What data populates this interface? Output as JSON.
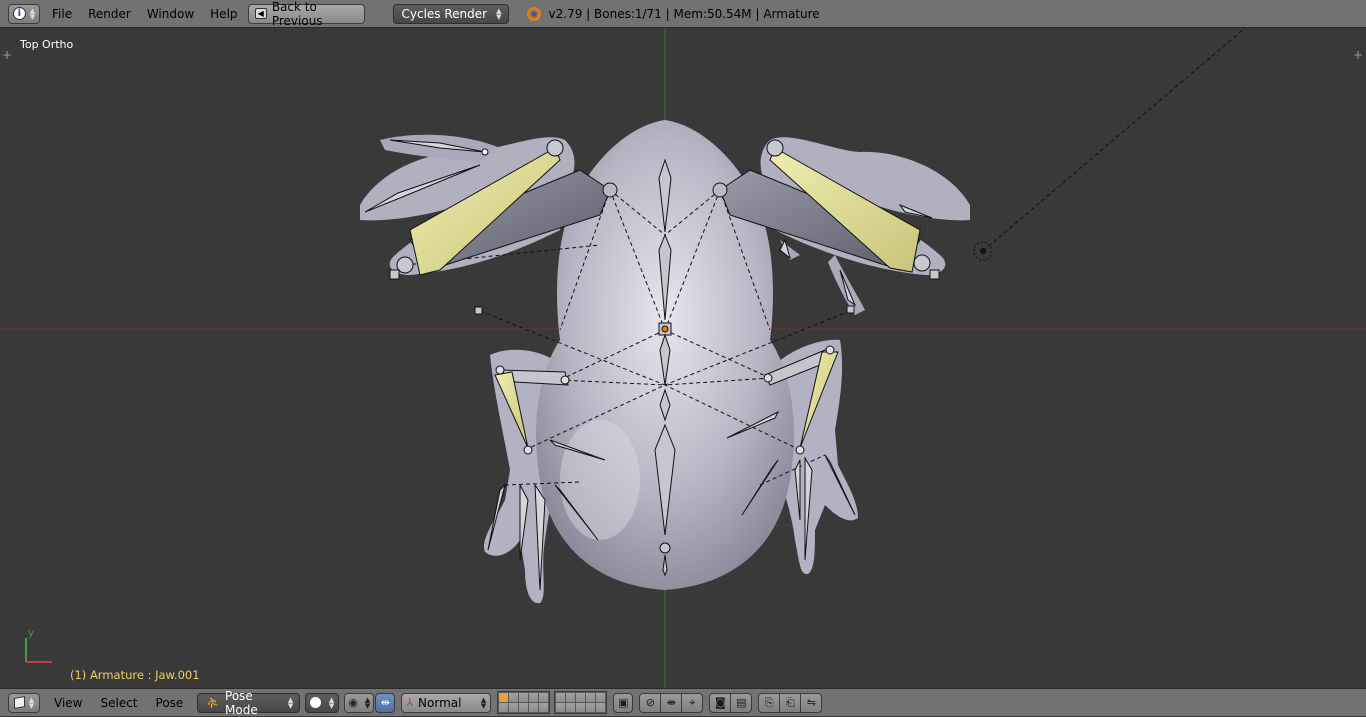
{
  "top_menu": {
    "items": [
      "File",
      "Render",
      "Window",
      "Help"
    ],
    "back_button": "Back to Previous",
    "render_engine": "Cycles Render",
    "stats": "v2.79 | Bones:1/71  | Mem:50.54M | Armature"
  },
  "viewport": {
    "view_label": "Top Ortho",
    "object_info": "(1) Armature : Jaw.001",
    "axis_y": "y",
    "colors": {
      "background": "#393939",
      "grid": "#444444",
      "x_axis": "#7a3030",
      "y_axis": "#2f7a2f",
      "mesh": "#c8c8d4",
      "selected_bone": "#e6e296"
    }
  },
  "bottom_bar": {
    "view": "View",
    "select": "Select",
    "pose": "Pose",
    "mode": "Pose Mode",
    "orientation": "Normal"
  }
}
